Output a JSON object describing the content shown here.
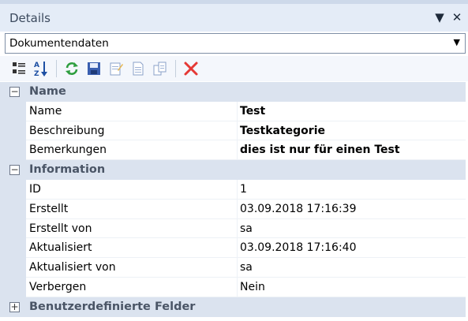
{
  "panel": {
    "title": "Details"
  },
  "selector": {
    "value": "Dokumentendaten"
  },
  "toolbar": {
    "icons": [
      "categorized-icon",
      "sort-alpha-icon",
      "refresh-icon",
      "save-icon",
      "edit-icon",
      "document-icon",
      "copy-icon",
      "delete-icon"
    ]
  },
  "categories": [
    {
      "name": "Name",
      "expanded": true,
      "rows": [
        {
          "label": "Name",
          "value": "Test",
          "bold": true
        },
        {
          "label": "Beschreibung",
          "value": "Testkategorie",
          "bold": true
        },
        {
          "label": "Bemerkungen",
          "value": "dies ist nur für einen Test",
          "bold": true
        }
      ]
    },
    {
      "name": "Information",
      "expanded": true,
      "rows": [
        {
          "label": "ID",
          "value": "1",
          "bold": false
        },
        {
          "label": "Erstellt",
          "value": "03.09.2018 17:16:39",
          "bold": false
        },
        {
          "label": "Erstellt von",
          "value": "sa",
          "bold": false
        },
        {
          "label": "Aktualisiert",
          "value": "03.09.2018 17:16:40",
          "bold": false
        },
        {
          "label": "Aktualisiert von",
          "value": "sa",
          "bold": false
        },
        {
          "label": "Verbergen",
          "value": "Nein",
          "bold": false
        }
      ]
    },
    {
      "name": "Benutzerdefinierte Felder",
      "expanded": false,
      "rows": []
    }
  ],
  "colors": {
    "titlebar": "#e4ecf7",
    "category": "#dbe3ef",
    "delete": "#e53935",
    "refresh": "#2e9e3f"
  }
}
